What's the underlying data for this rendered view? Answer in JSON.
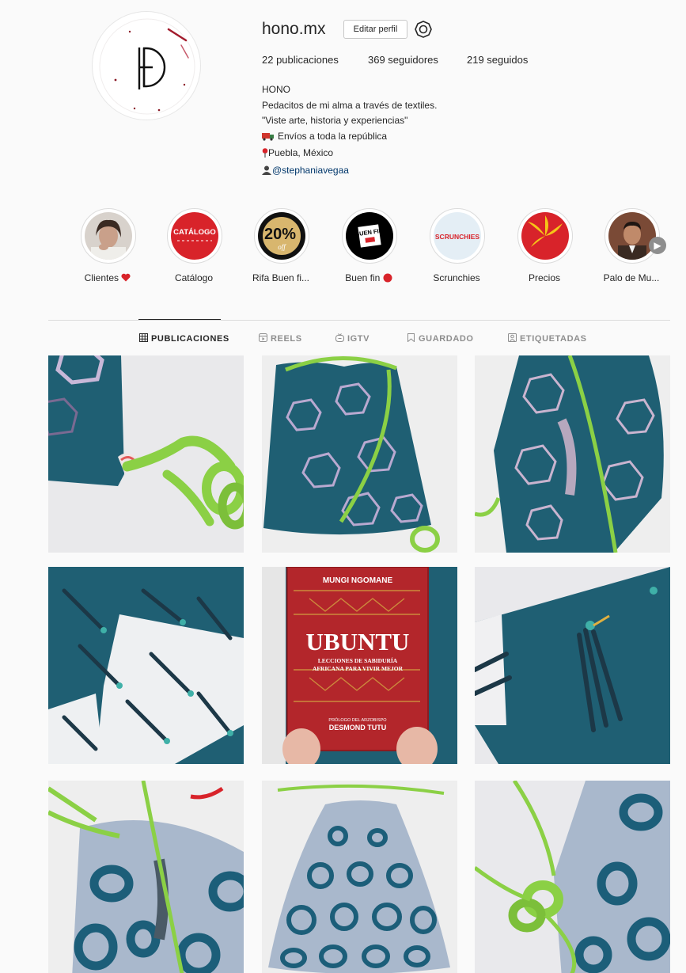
{
  "profile": {
    "username": "hono.mx",
    "edit_label": "Editar perfil",
    "settings_icon": "gear-icon",
    "stats": {
      "posts": "22 publicaciones",
      "followers": "369 seguidores",
      "following": "219 seguidos"
    },
    "bio": {
      "name": "HONO",
      "line1": "Pedacitos de mi alma a través de textiles.",
      "line2": "\"Viste arte, historia y experiencias\"",
      "line3": "Envíos a toda la república",
      "line4": "Puebla, México",
      "mention": "@stephaniavegaa",
      "icons": [
        "delivery-truck-icon",
        "round-pushpin-icon",
        "person-icon"
      ]
    }
  },
  "stories": [
    {
      "label": "Clientes",
      "icon": "heart-icon"
    },
    {
      "label": "Catálogo",
      "cover_text": "CATÁLOGO"
    },
    {
      "label": "Rifa Buen fi...",
      "cover_text": "20%",
      "cover_subtext": "off"
    },
    {
      "label": "Buen fin",
      "icon": "red-circle-icon",
      "cover_text": "BUEN FIN"
    },
    {
      "label": "Scrunchies",
      "cover_text": "SCRUNCHIES"
    },
    {
      "label": "Precios"
    },
    {
      "label": "Palo de Mu..."
    }
  ],
  "tabs": [
    {
      "label": "PUBLICACIONES",
      "icon": "grid-icon",
      "active": true
    },
    {
      "label": "REELS",
      "icon": "reels-icon",
      "active": false
    },
    {
      "label": "IGTV",
      "icon": "igtv-icon",
      "active": false
    },
    {
      "label": "GUARDADO",
      "icon": "bookmark-icon",
      "active": false
    },
    {
      "label": "ETIQUETADAS",
      "icon": "tagged-icon",
      "active": false
    }
  ],
  "book_cover": {
    "author": "MUNGI NGOMANE",
    "title": "UBUNTU",
    "subtitle_1": "LECCIONES DE SABIDURÍA",
    "subtitle_2": "AFRICANA PARA VIVIR MEJOR",
    "prologue": "PRÓLOGO DEL ARZOBISPO",
    "prologue_author": "DESMOND TUTU"
  },
  "colors": {
    "teal_fabric": "#1f5f73",
    "pale_fabric": "#a9b8cc",
    "rope_green": "#8bd045",
    "accent_red": "#d8232a",
    "link": "#00376b"
  }
}
